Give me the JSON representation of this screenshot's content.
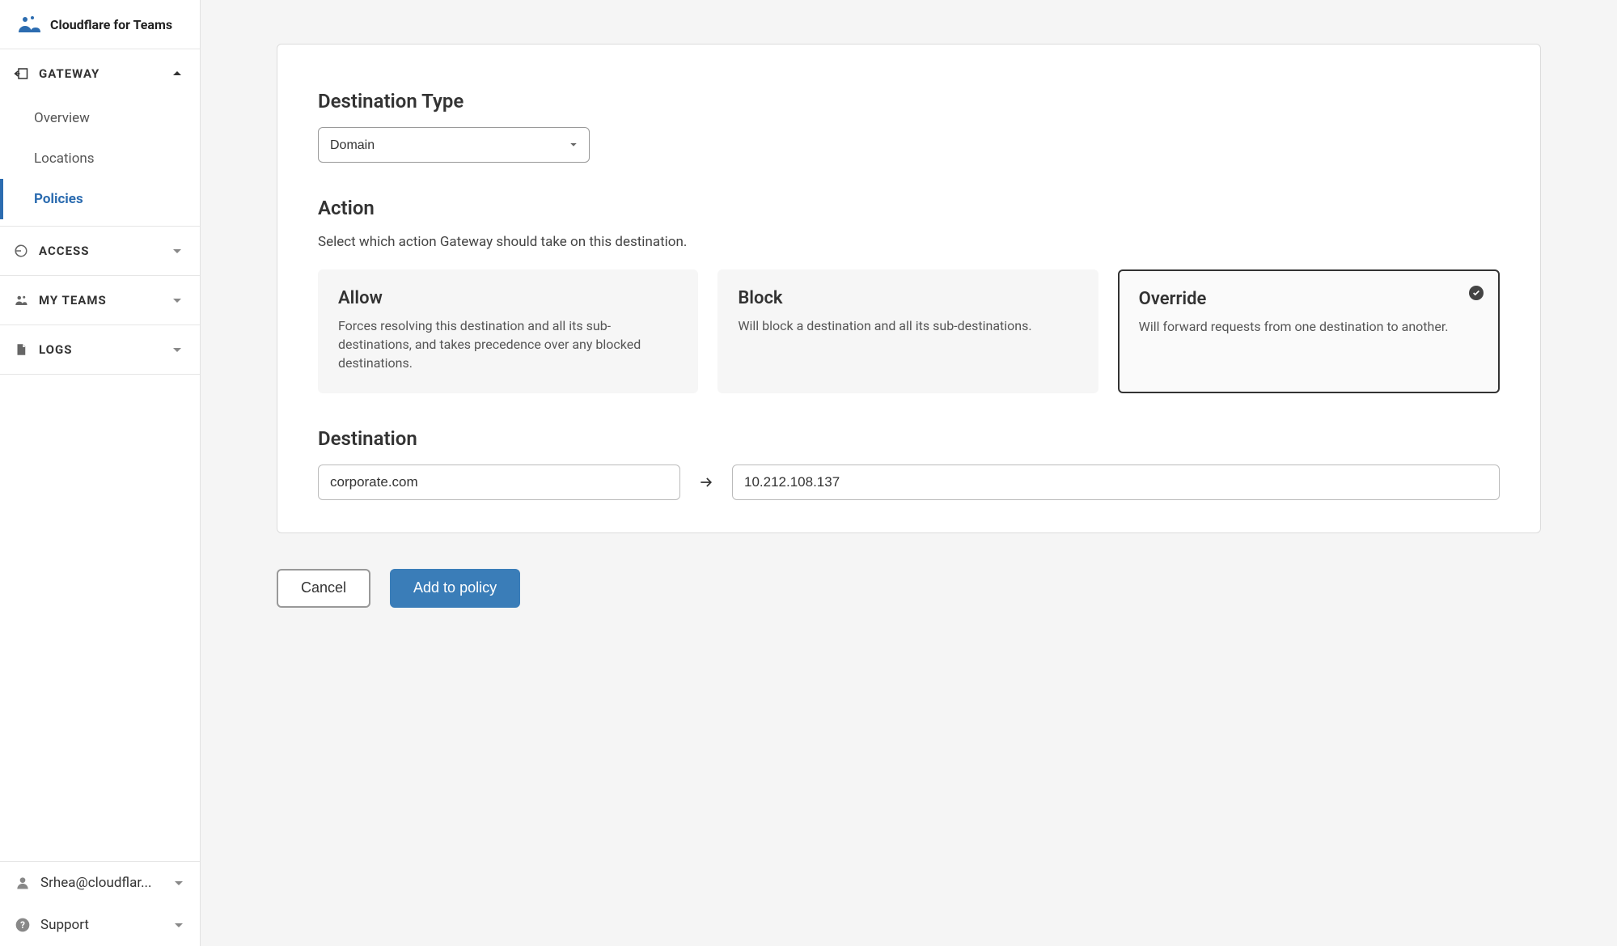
{
  "brand": {
    "name": "Cloudflare for Teams"
  },
  "sidebar": {
    "gateway": {
      "label": "GATEWAY",
      "items": [
        {
          "label": "Overview"
        },
        {
          "label": "Locations"
        },
        {
          "label": "Policies"
        }
      ]
    },
    "access": {
      "label": "ACCESS"
    },
    "myteams": {
      "label": "MY TEAMS"
    },
    "logs": {
      "label": "LOGS"
    }
  },
  "footer": {
    "email": "Srhea@cloudflar...",
    "support": "Support"
  },
  "destinationType": {
    "heading": "Destination Type",
    "selected": "Domain"
  },
  "action": {
    "heading": "Action",
    "description": "Select which action Gateway should take on this destination.",
    "options": [
      {
        "title": "Allow",
        "desc": "Forces resolving this destination and all its sub-destinations, and takes precedence over any blocked destinations."
      },
      {
        "title": "Block",
        "desc": "Will block a destination and all its sub-destinations."
      },
      {
        "title": "Override",
        "desc": "Will forward requests from one destination to another."
      }
    ]
  },
  "destination": {
    "heading": "Destination",
    "from": "corporate.com",
    "to": "10.212.108.137"
  },
  "buttons": {
    "cancel": "Cancel",
    "addToPolicy": "Add to policy"
  }
}
